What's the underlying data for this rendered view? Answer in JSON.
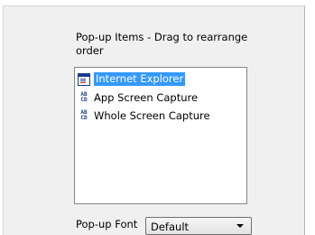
{
  "popup_items": {
    "title": "Pop-up Items - Drag to rearrange order",
    "items": [
      {
        "label": "Internet Explorer",
        "icon": "internet-explorer-icon",
        "selected": true
      },
      {
        "label": "App Screen Capture",
        "icon": "abcd-icon",
        "selected": false
      },
      {
        "label": "Whole Screen Capture",
        "icon": "abcd-icon",
        "selected": false
      }
    ]
  },
  "popup_font": {
    "label": "Pop-up Font",
    "value": "Default"
  },
  "icon_text": "AB\nCD"
}
